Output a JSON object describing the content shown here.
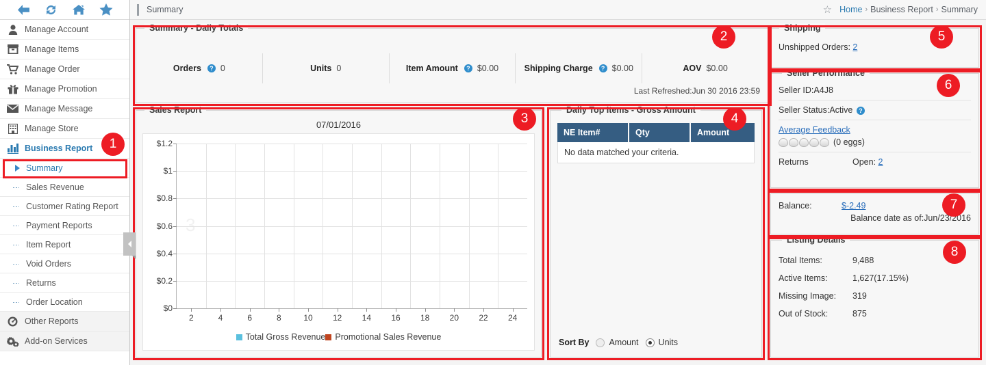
{
  "nav_icons": [
    {
      "name": "back-icon",
      "label": "Back"
    },
    {
      "name": "refresh-icon",
      "label": "Refresh"
    },
    {
      "name": "home-icon",
      "label": "Home"
    },
    {
      "name": "favorite-star-icon",
      "label": "Favorites"
    }
  ],
  "sidebar": {
    "items": [
      {
        "label": "Manage Account",
        "icon": "user-icon"
      },
      {
        "label": "Manage Items",
        "icon": "box-icon"
      },
      {
        "label": "Manage Order",
        "icon": "cart-icon"
      },
      {
        "label": "Manage Promotion",
        "icon": "gift-icon"
      },
      {
        "label": "Manage Message",
        "icon": "envelope-icon"
      },
      {
        "label": "Manage Store",
        "icon": "building-icon"
      },
      {
        "label": "Business Report",
        "icon": "bar-chart-icon"
      }
    ],
    "sub_items": [
      {
        "label": "Summary"
      },
      {
        "label": "Sales Revenue"
      },
      {
        "label": "Customer Rating Report"
      },
      {
        "label": "Payment Reports"
      },
      {
        "label": "Item Report"
      },
      {
        "label": "Void Orders"
      },
      {
        "label": "Returns"
      },
      {
        "label": "Order Location"
      }
    ],
    "footer_items": [
      {
        "label": "Other Reports",
        "icon": "gauge-icon"
      },
      {
        "label": "Add-on Services",
        "icon": "gears-icon"
      }
    ]
  },
  "topbar": {
    "page_title": "Summary",
    "breadcrumb": {
      "home": "Home",
      "sep1": "›",
      "section": "Business Report",
      "sep2": "›",
      "current": "Summary"
    }
  },
  "summary_totals": {
    "legend": "Summary - Daily Totals",
    "cells": [
      {
        "label": "Orders",
        "value": "0",
        "has_help": true
      },
      {
        "label": "Units",
        "value": "0",
        "has_help": false
      },
      {
        "label": "Item Amount",
        "value": "$0.00",
        "has_help": true
      },
      {
        "label": "Shipping Charge",
        "value": "$0.00",
        "has_help": true
      },
      {
        "label": "AOV",
        "value": "$0.00",
        "has_help": false
      }
    ],
    "last_refreshed": "Last Refreshed:Jun 30 2016 23:59"
  },
  "sales_report": {
    "legend": "Sales Report",
    "date": "07/01/2016",
    "watermark": "3"
  },
  "chart_data": {
    "type": "bar",
    "title": "07/01/2016",
    "xlabel": "",
    "ylabel": "",
    "x": [
      2,
      4,
      6,
      8,
      10,
      12,
      14,
      16,
      18,
      20,
      22,
      24
    ],
    "xticklabels": [
      "2",
      "4",
      "6",
      "8",
      "10",
      "12",
      "14",
      "16",
      "18",
      "20",
      "22",
      "24"
    ],
    "yticklabels": [
      "$0",
      "$0.2",
      "$0.4",
      "$0.6",
      "$0.8",
      "$1",
      "$1.2"
    ],
    "yticks": [
      0,
      0.2,
      0.4,
      0.6,
      0.8,
      1,
      1.2
    ],
    "ylim": [
      0,
      1.2
    ],
    "grid": true,
    "legend_position": "bottom",
    "series": [
      {
        "name": "Total Gross Revenue",
        "color": "#5bc0de",
        "values": [
          0,
          0,
          0,
          0,
          0,
          0,
          0,
          0,
          0,
          0,
          0,
          0
        ]
      },
      {
        "name": "Promotional Sales Revenue",
        "color": "#c0441f",
        "values": [
          0,
          0,
          0,
          0,
          0,
          0,
          0,
          0,
          0,
          0,
          0,
          0
        ]
      }
    ]
  },
  "daily_top_items": {
    "legend": "Daily Top Items - Gross Amount",
    "columns": [
      "NE Item#",
      "Qty",
      "Amount"
    ],
    "empty_message": "No data matched your criteria.",
    "sort_by_label": "Sort By",
    "sort_options": [
      {
        "label": "Amount",
        "selected": false
      },
      {
        "label": "Units",
        "selected": true
      }
    ]
  },
  "shipping": {
    "legend": "Shipping",
    "unshipped_label": "Unshipped Orders:",
    "unshipped_value": "2"
  },
  "seller_performance": {
    "legend": "Seller Performance",
    "seller_id": "Seller ID:A4J8",
    "seller_status": "Seller Status:Active",
    "average_feedback_link": "Average Feedback",
    "egg_count": 5,
    "egg_text": "(0 eggs)",
    "returns_label": "Returns",
    "returns_open_label": "Open:",
    "returns_open_value": "2"
  },
  "balance": {
    "label": "Balance:",
    "value": "$-2.49",
    "as_of": "Balance date as of:Jun/23/2016"
  },
  "listing_details": {
    "legend": "Listing Details",
    "rows": [
      {
        "key": "Total Items:",
        "value": "9,488"
      },
      {
        "key": "Active Items:",
        "value": "1,627(17.15%)"
      },
      {
        "key": "Missing Image:",
        "value": "319"
      },
      {
        "key": "Out of Stock:",
        "value": "875"
      }
    ]
  },
  "annotations": {
    "badges": [
      "1",
      "2",
      "3",
      "4",
      "5",
      "6",
      "7",
      "8"
    ],
    "color": "#ed1c24"
  }
}
